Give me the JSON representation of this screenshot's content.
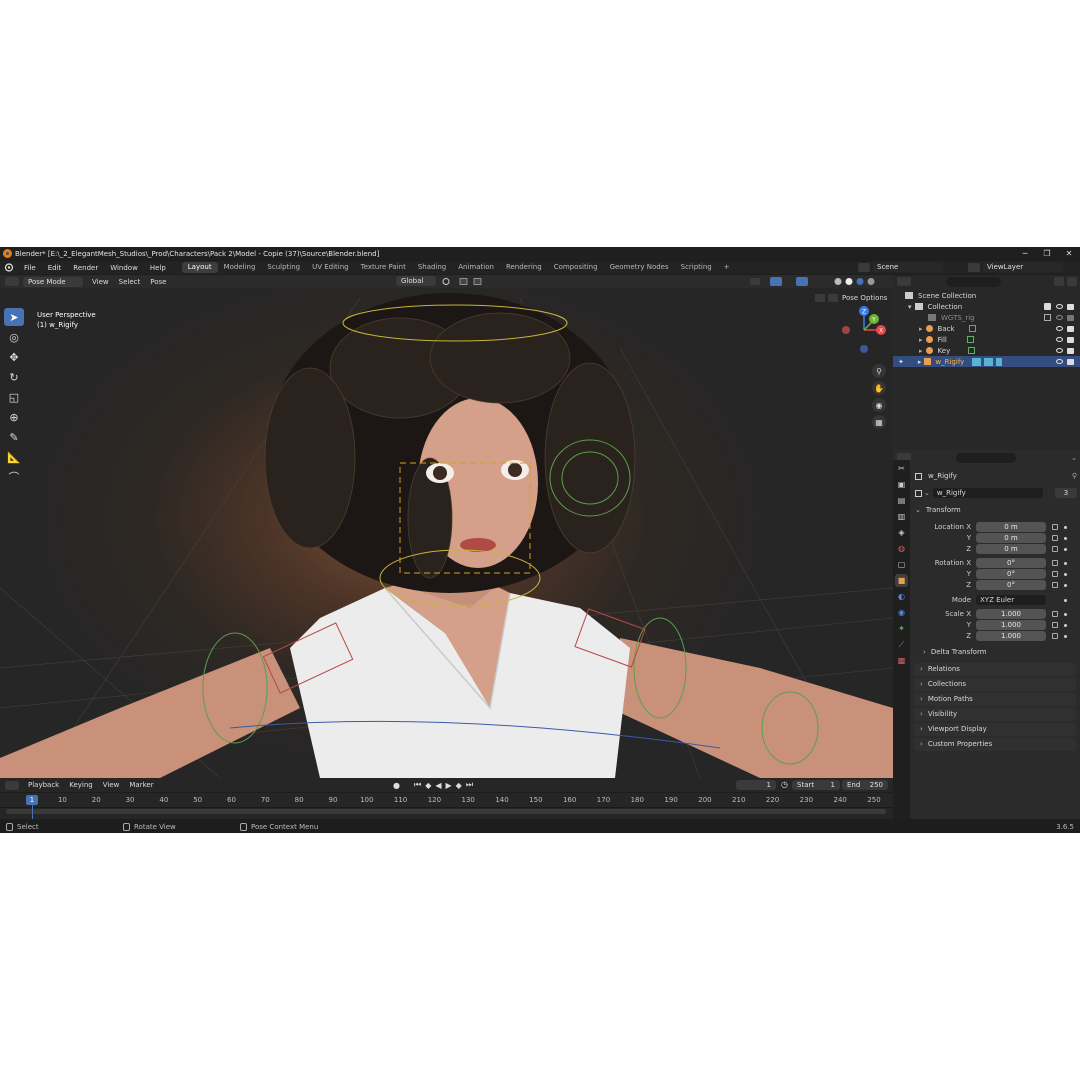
{
  "title_bar": {
    "text": "Blender* [E:\\_2_ElegantMesh_Studios\\_Prod\\Characters\\Pack 2\\Model - Copie (37)\\Source\\Blender.blend]",
    "minimize": "─",
    "maximize": "❐",
    "close": "✕"
  },
  "menu": {
    "items": [
      "File",
      "Edit",
      "Render",
      "Window",
      "Help"
    ]
  },
  "workspaces": [
    "Layout",
    "Modeling",
    "Sculpting",
    "UV Editing",
    "Texture Paint",
    "Shading",
    "Animation",
    "Rendering",
    "Compositing",
    "Geometry Nodes",
    "Scripting"
  ],
  "workspace_add": "+",
  "scene": {
    "label": "Scene",
    "view_layer": "ViewLayer"
  },
  "viewport_header": {
    "mode": "Pose Mode",
    "view": "View",
    "select": "Select",
    "pose": "Pose",
    "orientation": "Global",
    "pose_options": "Pose Options"
  },
  "viewport": {
    "perspective": "User Perspective",
    "object": "(1) w_Rigify",
    "gizmo": {
      "z": "Z",
      "y": "Y",
      "x": "X"
    }
  },
  "timeline": {
    "playback": "Playback",
    "keying": "Keying",
    "view": "View",
    "marker": "Marker",
    "current_frame": "1",
    "start_label": "Start",
    "start": "1",
    "end_label": "End",
    "end": "250",
    "ticks": [
      "1",
      "10",
      "20",
      "30",
      "40",
      "50",
      "60",
      "70",
      "80",
      "90",
      "100",
      "110",
      "120",
      "130",
      "140",
      "150",
      "160",
      "170",
      "180",
      "190",
      "200",
      "210",
      "220",
      "230",
      "240",
      "250"
    ]
  },
  "status_bar": {
    "select": "Select",
    "rotate": "Rotate View",
    "context": "Pose Context Menu",
    "version": "3.6.5"
  },
  "outliner": {
    "scene_collection": "Scene Collection",
    "collection": "Collection",
    "items": [
      "WGTS_rig",
      "Back",
      "Fill",
      "Key",
      "w_Rigify"
    ]
  },
  "properties": {
    "object_name": "w_Rigify",
    "data_name": "w_Rigify",
    "users": "3",
    "transform_label": "Transform",
    "location": {
      "label": "Location X",
      "y_label": "Y",
      "z_label": "Z",
      "x": "0 m",
      "y": "0 m",
      "z": "0 m"
    },
    "rotation": {
      "label": "Rotation X",
      "y_label": "Y",
      "z_label": "Z",
      "x": "0°",
      "y": "0°",
      "z": "0°"
    },
    "mode_label": "Mode",
    "mode": "XYZ Euler",
    "scale": {
      "label": "Scale X",
      "y_label": "Y",
      "z_label": "Z",
      "x": "1.000",
      "y": "1.000",
      "z": "1.000"
    },
    "delta_transform": "Delta Transform",
    "panels": [
      "Relations",
      "Collections",
      "Motion Paths",
      "Visibility",
      "Viewport Display",
      "Custom Properties"
    ]
  },
  "colors": {
    "accent": "#4772b3",
    "selection": "#334d80",
    "background": "#1d1d1d",
    "header": "#2b2b2b",
    "skin": "#d4a089",
    "shirt": "#ececec",
    "hair": "#1a1512"
  }
}
